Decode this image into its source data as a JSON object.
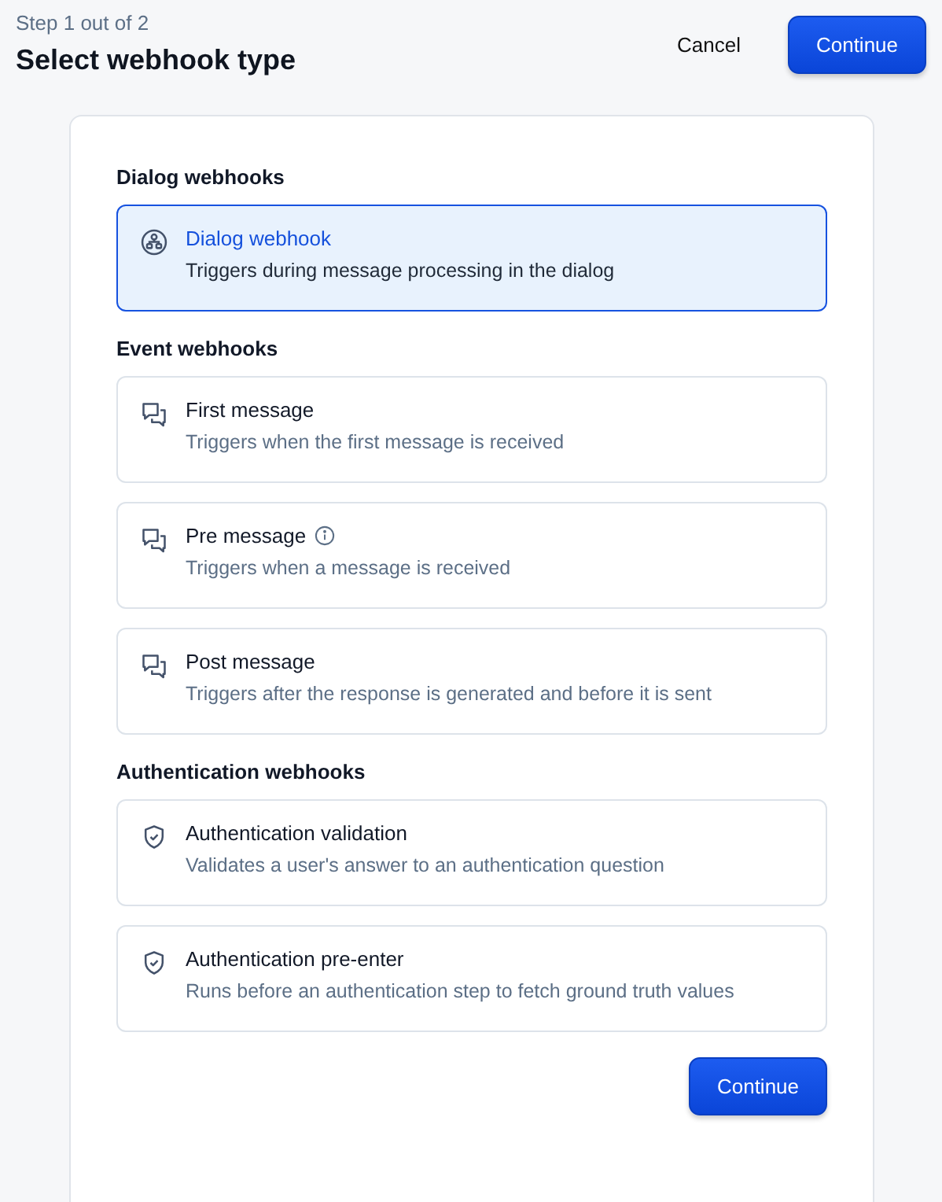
{
  "header": {
    "step": "Step 1 out of 2",
    "title": "Select webhook type",
    "cancel": "Cancel",
    "continue": "Continue"
  },
  "groups": [
    {
      "heading": "Dialog webhooks",
      "items": [
        {
          "kind": "flow",
          "title": "Dialog webhook",
          "description": "Triggers during message processing in the dialog",
          "selected": true,
          "info": false
        }
      ]
    },
    {
      "heading": "Event webhooks",
      "items": [
        {
          "kind": "chat",
          "title": "First message",
          "description": "Triggers when the first message is received",
          "selected": false,
          "info": false
        },
        {
          "kind": "chat",
          "title": "Pre message",
          "description": "Triggers when a message is received",
          "selected": false,
          "info": true
        },
        {
          "kind": "chat",
          "title": "Post message",
          "description": "Triggers after the response is generated and before it is sent",
          "selected": false,
          "info": false
        }
      ]
    },
    {
      "heading": "Authentication webhooks",
      "items": [
        {
          "kind": "shield",
          "title": "Authentication validation",
          "description": "Validates a user's answer to an authentication question",
          "selected": false,
          "info": false
        },
        {
          "kind": "shield",
          "title": "Authentication pre-enter",
          "description": "Runs before an authentication step to fetch ground truth values",
          "selected": false,
          "info": false
        }
      ]
    }
  ],
  "footer": {
    "continue": "Continue"
  }
}
